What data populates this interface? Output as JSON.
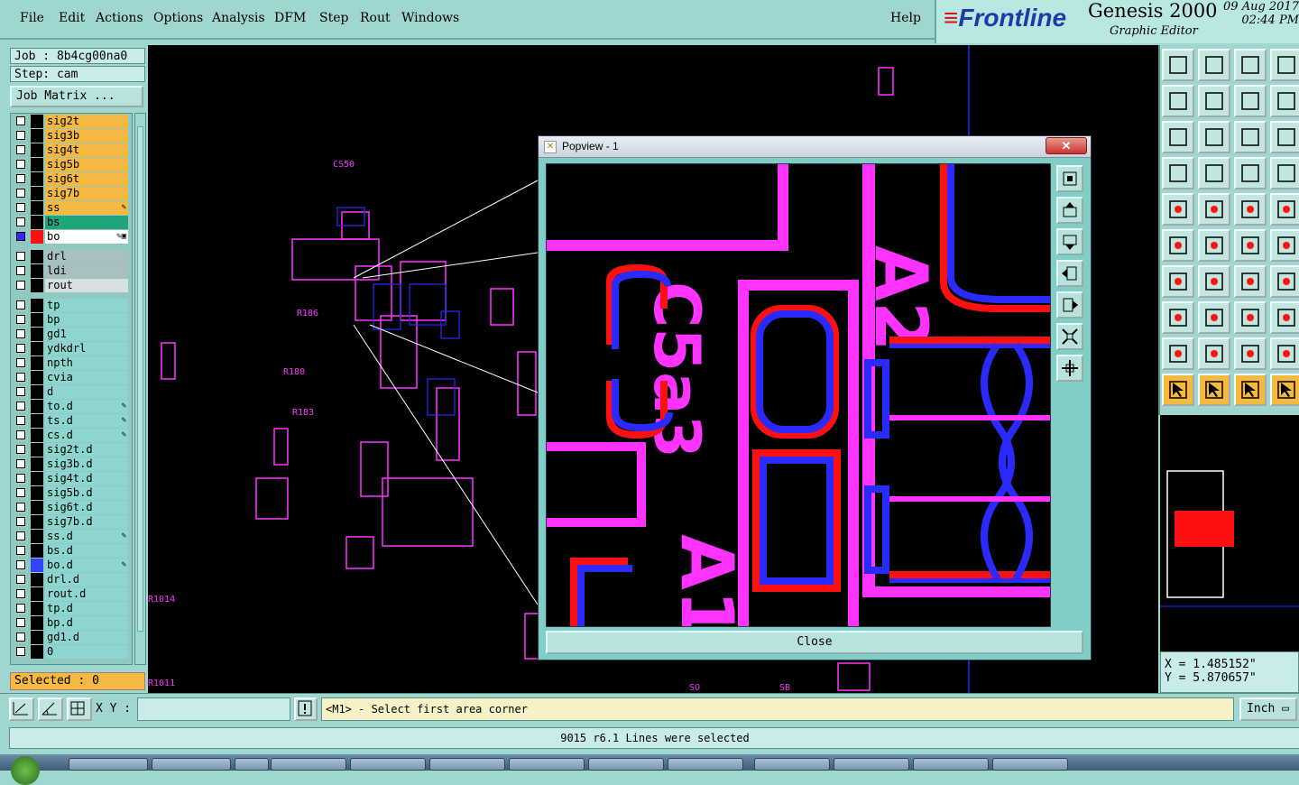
{
  "menu": [
    "File",
    "Edit",
    "Actions",
    "Options",
    "Analysis",
    "DFM",
    "Step",
    "Rout",
    "Windows"
  ],
  "help": "Help",
  "brand": {
    "logo": "Frontline",
    "product": "Genesis 2000",
    "subtitle": "Graphic Editor",
    "date": "09 Aug 2017",
    "time": "02:44 PM"
  },
  "job": {
    "job_label": "Job : 8b4cg00na0",
    "step_label": "Step: cam",
    "job_matrix": "Job Matrix ..."
  },
  "layers": [
    {
      "name": "sig2t",
      "color": "#f5b840",
      "flag": ""
    },
    {
      "name": "sig3b",
      "color": "#f5b840",
      "flag": ""
    },
    {
      "name": "sig4t",
      "color": "#f5b840",
      "flag": ""
    },
    {
      "name": "sig5b",
      "color": "#f5b840",
      "flag": ""
    },
    {
      "name": "sig6t",
      "color": "#f5b840",
      "flag": ""
    },
    {
      "name": "sig7b",
      "color": "#f5b840",
      "flag": ""
    },
    {
      "name": "ss",
      "color": "#f5b840",
      "flag": "✎"
    },
    {
      "name": "bs",
      "color": "#1fa57a",
      "flag": ""
    },
    {
      "name": "bo",
      "color": "#ffffff",
      "flag": "✎▣",
      "active": true
    },
    {
      "name": "drl",
      "color": "#a9bfc0",
      "flag": ""
    },
    {
      "name": "ldi",
      "color": "#a9bfc0",
      "flag": ""
    },
    {
      "name": "rout",
      "color": "#d6e0e0",
      "flag": ""
    },
    {
      "name": "tp",
      "color": "#8dd6d0",
      "flag": ""
    },
    {
      "name": "bp",
      "color": "#8dd6d0",
      "flag": ""
    },
    {
      "name": "gd1",
      "color": "#8dd6d0",
      "flag": ""
    },
    {
      "name": "ydkdrl",
      "color": "#8dd6d0",
      "flag": ""
    },
    {
      "name": "npth",
      "color": "#8dd6d0",
      "flag": ""
    },
    {
      "name": "cvia",
      "color": "#8dd6d0",
      "flag": ""
    },
    {
      "name": "d",
      "color": "#8dd6d0",
      "flag": ""
    },
    {
      "name": "to.d",
      "color": "#8dd6d0",
      "flag": "✎"
    },
    {
      "name": "ts.d",
      "color": "#8dd6d0",
      "flag": "✎"
    },
    {
      "name": "cs.d",
      "color": "#8dd6d0",
      "flag": "✎"
    },
    {
      "name": "sig2t.d",
      "color": "#8dd6d0",
      "flag": ""
    },
    {
      "name": "sig3b.d",
      "color": "#8dd6d0",
      "flag": ""
    },
    {
      "name": "sig4t.d",
      "color": "#8dd6d0",
      "flag": ""
    },
    {
      "name": "sig5b.d",
      "color": "#8dd6d0",
      "flag": ""
    },
    {
      "name": "sig6t.d",
      "color": "#8dd6d0",
      "flag": ""
    },
    {
      "name": "sig7b.d",
      "color": "#8dd6d0",
      "flag": ""
    },
    {
      "name": "ss.d",
      "color": "#8dd6d0",
      "flag": "✎"
    },
    {
      "name": "bs.d",
      "color": "#8dd6d0",
      "flag": ""
    },
    {
      "name": "bo.d",
      "color": "#8dd6d0",
      "flag": "✎",
      "swatch": "#3344ff"
    },
    {
      "name": "drl.d",
      "color": "#8dd6d0",
      "flag": ""
    },
    {
      "name": "rout.d",
      "color": "#8dd6d0",
      "flag": ""
    },
    {
      "name": "tp.d",
      "color": "#8dd6d0",
      "flag": ""
    },
    {
      "name": "bp.d",
      "color": "#8dd6d0",
      "flag": ""
    },
    {
      "name": "gd1.d",
      "color": "#8dd6d0",
      "flag": ""
    },
    {
      "name": "0",
      "color": "#8dd6d0",
      "flag": ""
    }
  ],
  "selected": "Selected : 0",
  "popview": {
    "title": "Popview - 1",
    "close": "Close",
    "labels": [
      "A2",
      "A1",
      "C5a3"
    ]
  },
  "coords": {
    "x": "X = 1.485152\"",
    "y": "Y = 5.870657\""
  },
  "cmd": {
    "xy_label": "X Y :",
    "xy_value": "",
    "prompt": "<M1> - Select first area corner",
    "unit": "Inch"
  },
  "status": "9015 r6.1 Lines were selected",
  "colors": {
    "panel": "#9fd7d0",
    "highlight": "#f5b840",
    "magenta": "#ff33ff",
    "red": "#ff1010",
    "blue": "#2a2aff"
  }
}
